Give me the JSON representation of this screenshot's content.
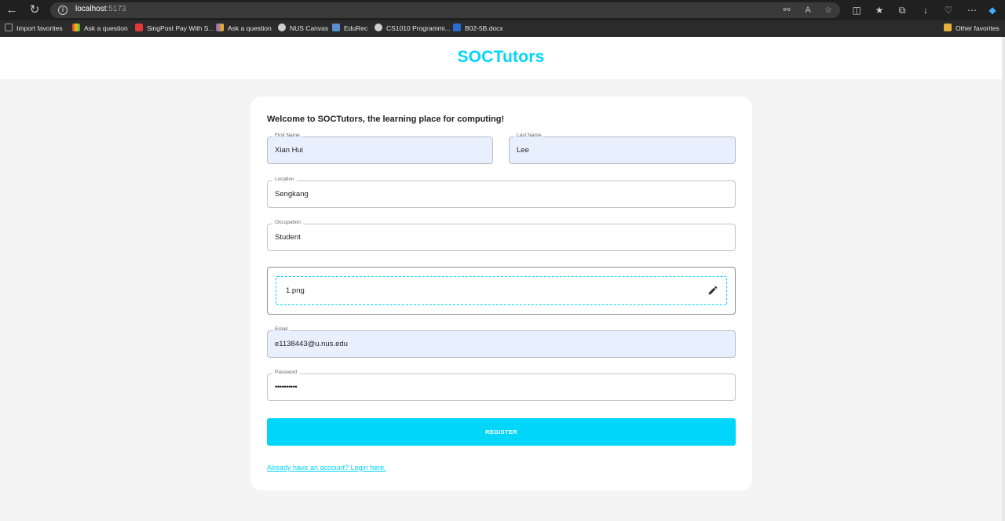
{
  "browser": {
    "url_host": "localhost",
    "url_port": ":5173",
    "bookmarks": [
      {
        "label": "Import favorites",
        "color": "#9e9e9e"
      },
      {
        "label": "Ask a question",
        "color": "#3a3a3a"
      },
      {
        "label": "SingPost Pay With S...",
        "color": "#e23a3a"
      },
      {
        "label": "Ask a question",
        "color": "#8a5cc7"
      },
      {
        "label": "NUS Canvas",
        "color": "#cfcfcf"
      },
      {
        "label": "EduRec",
        "color": "#5a8fd6"
      },
      {
        "label": "CS1010 Programmi...",
        "color": "#cfcfcf"
      },
      {
        "label": "B02-5B.docx",
        "color": "#2b6cd4"
      }
    ],
    "other_favorites": "Other favorites"
  },
  "app": {
    "brand": "SOCTutors",
    "brand_color": "#00d5fa",
    "welcome": "Welcome to SOCTutors, the learning place for computing!",
    "fields": {
      "first_name": {
        "label": "First Name",
        "value": "Xian Hui"
      },
      "last_name": {
        "label": "Last Name",
        "value": "Lee"
      },
      "location": {
        "label": "Location",
        "value": "Sengkang"
      },
      "occupation": {
        "label": "Occupation",
        "value": "Student"
      },
      "email": {
        "label": "Email",
        "value": "e1138443@u.nus.edu"
      },
      "password": {
        "label": "Password",
        "value": "••••••••••"
      }
    },
    "upload": {
      "file_name": "1.png",
      "icon": "pencil-icon"
    },
    "register_label": "REGISTER",
    "login_link": "Already have an account? Login here."
  }
}
